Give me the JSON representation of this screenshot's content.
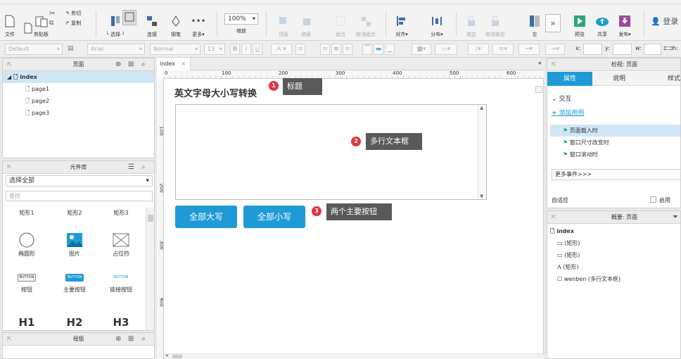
{
  "toolbar": {
    "file": "文件",
    "clipboard": "剪贴板",
    "cut": "剪切",
    "copy": "复制",
    "select": "选择",
    "connect": "连接",
    "pen": "钢笔",
    "more": "更多▾",
    "zoom": "100%",
    "zoom_label": "缩放",
    "top": "顶层",
    "bottom": "底层",
    "group": "组合",
    "ungroup": "取消组合",
    "align": "对齐▾",
    "distribute": "分布▾",
    "lock": "锁定",
    "unlock": "取消锁定",
    "left": "左",
    "preview": "预览",
    "share": "共享",
    "publish": "发布▾",
    "login": "登录"
  },
  "format": {
    "style": "Default",
    "font": "Arial",
    "weight": "Normal",
    "size": "13",
    "x_label": "x:",
    "y_label": "y:",
    "w_label": "w:",
    "h_label": "h:"
  },
  "pages_panel": {
    "title": "页面",
    "root": "index",
    "pages": [
      "page1",
      "page2",
      "page3"
    ]
  },
  "library_panel": {
    "title": "元件库",
    "selector": "选择全部",
    "search_placeholder": "查找",
    "items": [
      {
        "label": "矩形1"
      },
      {
        "label": "矩形2"
      },
      {
        "label": "矩形3"
      },
      {
        "label": "椭圆形"
      },
      {
        "label": "图片"
      },
      {
        "label": "占位符"
      },
      {
        "label": "按钮",
        "preview": "BUTTON"
      },
      {
        "label": "主要按钮",
        "preview": "BUTTON"
      },
      {
        "label": "链接按钮",
        "preview": "BUTTON"
      },
      {
        "label": "H1"
      },
      {
        "label": "H2"
      },
      {
        "label": "H3"
      }
    ]
  },
  "masters_panel": {
    "title": "母版"
  },
  "canvas": {
    "tab": "index",
    "ruler_h": [
      "0",
      "100",
      "200",
      "300",
      "400",
      "500",
      "600"
    ],
    "ruler_v": [
      "100",
      "200",
      "300",
      "400"
    ],
    "heading": "英文字母大小写转换",
    "btn_upper": "全部大写",
    "btn_lower": "全部小写",
    "notes": [
      {
        "num": "1",
        "text": "标题"
      },
      {
        "num": "2",
        "text": "多行文本框"
      },
      {
        "num": "3",
        "text": "两个主要按钮"
      }
    ]
  },
  "inspector": {
    "title": "检视: 页面",
    "tabs": [
      "属性",
      "说明",
      "样式"
    ],
    "interaction": "交互",
    "add_case": "添加用例",
    "events": [
      "页面载入时",
      "窗口尺寸改变时",
      "窗口滚动时"
    ],
    "more_events": "更多事件>>>",
    "adaptive": "自适应",
    "enable": "启用"
  },
  "outline": {
    "title": "概要: 页面",
    "root": "index",
    "items": [
      {
        "icon": "rect-icon",
        "label": "(矩形)"
      },
      {
        "icon": "rect-icon",
        "label": "(矩形)"
      },
      {
        "icon": "text-icon",
        "label": "(矩形)"
      },
      {
        "icon": "textarea-icon",
        "label": "wenben (多行文本框)"
      }
    ]
  },
  "colors": {
    "accent": "#1e9bd7",
    "marker": "#e0383e",
    "note_bg": "#595959",
    "selected_row": "#cfe6f6"
  }
}
